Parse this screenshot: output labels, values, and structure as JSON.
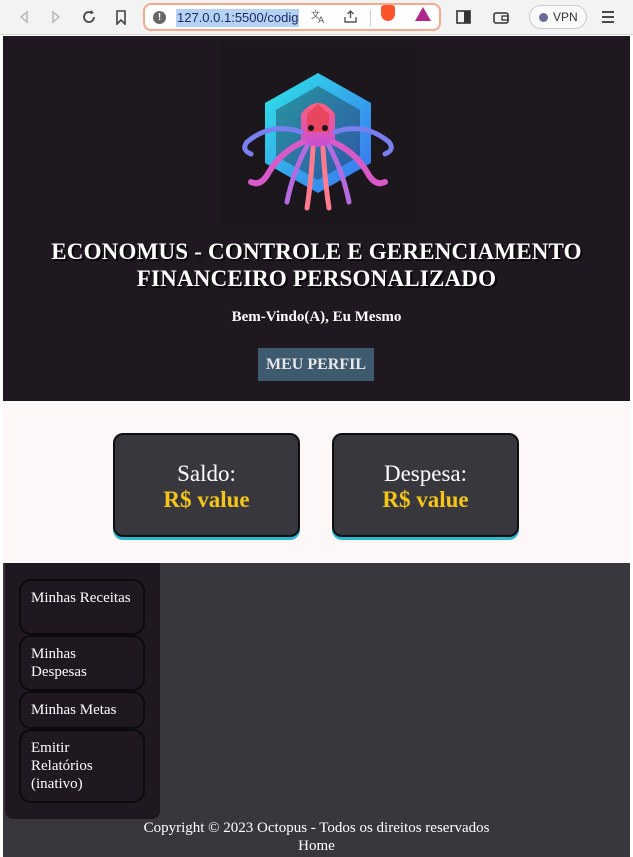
{
  "browser": {
    "url": "127.0.0.1:5500/codig",
    "vpn_label": "VPN"
  },
  "header": {
    "title": "ECONOMUS - CONTROLE E GERENCIAMENTO FINANCEIRO PERSONALIZADO",
    "welcome": "Bem-Vindo(A), Eu Mesmo",
    "profile_button": "MEU PERFIL"
  },
  "cards": [
    {
      "label": "Saldo:",
      "value": "R$ value"
    },
    {
      "label": "Despesa:",
      "value": "R$ value"
    }
  ],
  "sidebar": {
    "items": [
      {
        "label": "Minhas Receitas"
      },
      {
        "label": "Minhas Despesas"
      },
      {
        "label": "Minhas Metas"
      },
      {
        "label": "Emitir Relatórios (inativo)"
      }
    ]
  },
  "footer": {
    "copyright": "Copyright © 2023 Octopus - Todos os direitos reservados",
    "home_link": "Home"
  },
  "colors": {
    "header_bg": "#1f1820",
    "card_bg": "#39373e",
    "card_value": "#f5c518",
    "card_accent": "#2ab7cf",
    "button_bg": "#3d5a6e"
  },
  "icons": [
    "back-icon",
    "forward-icon",
    "reload-icon",
    "bookmark-icon",
    "site-info-icon",
    "translate-icon",
    "share-icon",
    "brave-shield-icon",
    "brave-rewards-icon",
    "sidebar-toggle-icon",
    "wallet-icon",
    "menu-icon",
    "octopus-logo"
  ]
}
